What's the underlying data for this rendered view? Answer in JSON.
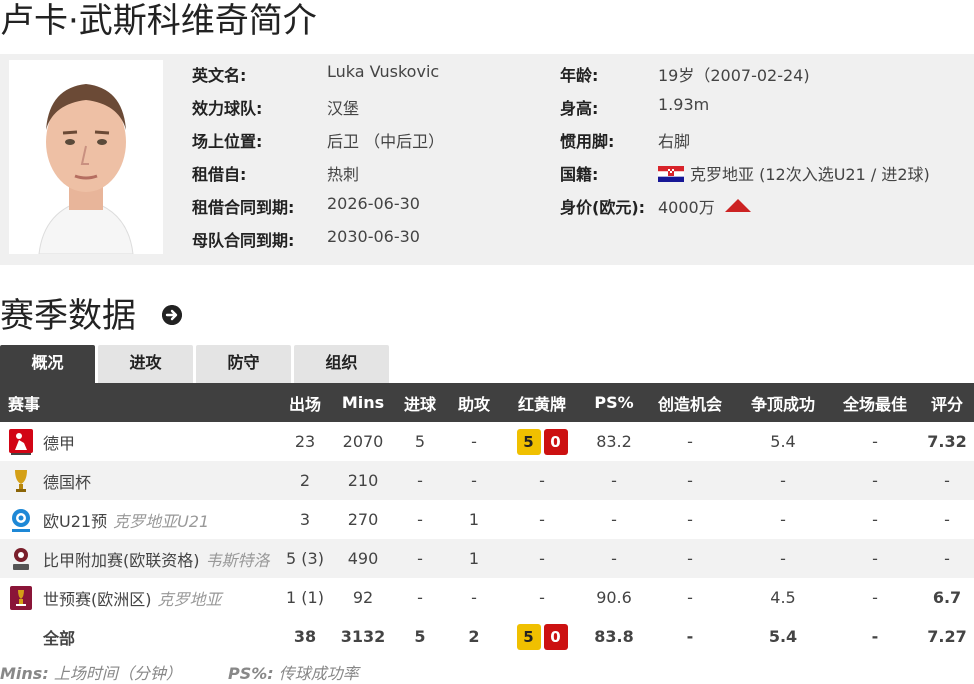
{
  "title": "卢卡·武斯科维奇简介",
  "profile": {
    "left": [
      {
        "label": "英文名:",
        "value": "Luka Vuskovic"
      },
      {
        "label": "效力球队:",
        "value": "汉堡"
      },
      {
        "label": "场上位置:",
        "value": "后卫 （中后卫）"
      },
      {
        "label": "租借自:",
        "value": "热刺"
      },
      {
        "label": "租借合同到期:",
        "value": "2026-06-30"
      },
      {
        "label": "母队合同到期:",
        "value": "2030-06-30"
      }
    ],
    "right": [
      {
        "label": "年龄:",
        "value": "19岁（2007-02-24)"
      },
      {
        "label": "身高:",
        "value": "1.93m"
      },
      {
        "label": "惯用脚:",
        "value": "右脚"
      },
      {
        "label": "国籍:",
        "value": "克罗地亚 (12次入选U21 / 进2球)"
      },
      {
        "label": "身价(欧元):",
        "value": "4000万"
      }
    ]
  },
  "season_title": "赛季数据",
  "tabs": [
    "概况",
    "进攻",
    "防守",
    "组织"
  ],
  "table": {
    "headers": [
      "赛事",
      "出场",
      "Mins",
      "进球",
      "助攻",
      "红黄牌",
      "PS%",
      "创造机会",
      "争顶成功",
      "全场最佳",
      "评分"
    ],
    "rows": [
      {
        "comp": "德甲",
        "note": "",
        "apps": "23",
        "mins": "2070",
        "goals": "5",
        "assists": "-",
        "yellow": "5",
        "red": "0",
        "ps": "83.2",
        "chances": "-",
        "aerial": "5.4",
        "motm": "-",
        "rating": "7.32"
      },
      {
        "comp": "德国杯",
        "note": "",
        "apps": "2",
        "mins": "210",
        "goals": "-",
        "assists": "-",
        "yellow": "",
        "red": "",
        "cards": "-",
        "ps": "-",
        "chances": "-",
        "aerial": "-",
        "motm": "-",
        "rating": "-"
      },
      {
        "comp": "欧U21预",
        "note": "克罗地亚U21",
        "apps": "3",
        "mins": "270",
        "goals": "-",
        "assists": "1",
        "yellow": "",
        "red": "",
        "cards": "-",
        "ps": "-",
        "chances": "-",
        "aerial": "-",
        "motm": "-",
        "rating": "-"
      },
      {
        "comp": "比甲附加赛(欧联资格)",
        "note": "韦斯特洛",
        "apps": "5 (3)",
        "mins": "490",
        "goals": "-",
        "assists": "1",
        "yellow": "",
        "red": "",
        "cards": "-",
        "ps": "-",
        "chances": "-",
        "aerial": "-",
        "motm": "-",
        "rating": "-"
      },
      {
        "comp": "世预赛(欧洲区)",
        "note": "克罗地亚",
        "apps": "1 (1)",
        "mins": "92",
        "goals": "-",
        "assists": "-",
        "yellow": "",
        "red": "",
        "cards": "-",
        "ps": "90.6",
        "chances": "-",
        "aerial": "4.5",
        "motm": "-",
        "rating": "6.7"
      }
    ],
    "total": {
      "comp": "全部",
      "apps": "38",
      "mins": "3132",
      "goals": "5",
      "assists": "2",
      "yellow": "5",
      "red": "0",
      "ps": "83.8",
      "chances": "-",
      "aerial": "5.4",
      "motm": "-",
      "rating": "7.27"
    }
  },
  "footnote": {
    "mins_key": "Mins:",
    "mins_desc": "上场时间（分钟）",
    "ps_key": "PS%:",
    "ps_desc": "传球成功率"
  },
  "colors": {
    "header_bg": "#404040",
    "rating": "#e06020",
    "yellow_card": "#f0c000",
    "red_card": "#cc1111",
    "value_up": "#cc2222"
  }
}
